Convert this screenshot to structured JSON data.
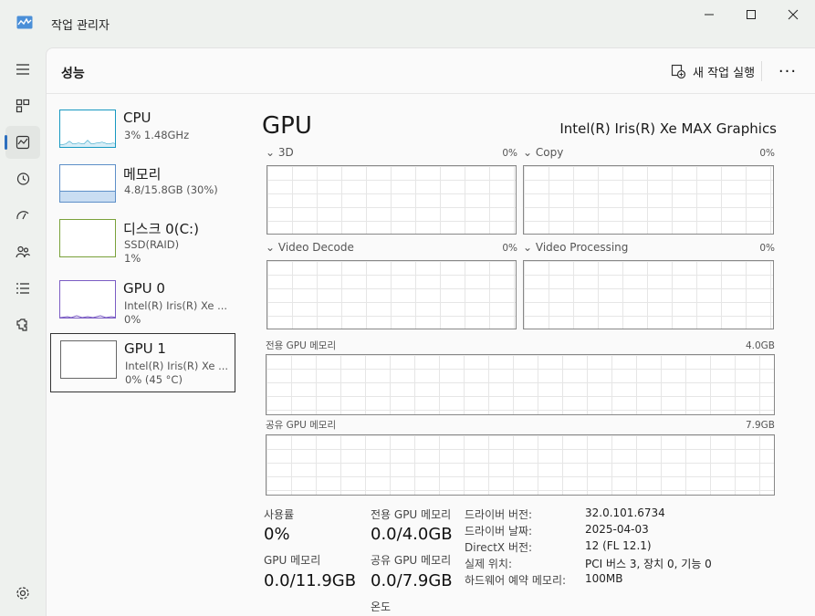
{
  "window": {
    "title": "작업 관리자"
  },
  "header": {
    "title": "성능",
    "new_task_label": "새 작업 실행",
    "more_label": "···"
  },
  "nav": {
    "icons": [
      "menu-icon",
      "processes-icon",
      "performance-icon",
      "app-history-icon",
      "startup-apps-icon",
      "users-icon",
      "details-icon",
      "services-icon",
      "settings-icon"
    ]
  },
  "devices": [
    {
      "name": "CPU",
      "line1": "3% 1.48GHz",
      "line2": ""
    },
    {
      "name": "메모리",
      "line1": "4.8/15.8GB (30%)",
      "line2": ""
    },
    {
      "name": "디스크 0(C:)",
      "line1": "SSD(RAID)",
      "line2": "1%"
    },
    {
      "name": "GPU 0",
      "line1": "Intel(R) Iris(R) Xe ...",
      "line2": "0%"
    },
    {
      "name": "GPU 1",
      "line1": "Intel(R) Iris(R) Xe ...",
      "line2": "0% (45 °C)"
    }
  ],
  "detail": {
    "title": "GPU",
    "model": "Intel(R) Iris(R) Xe MAX Graphics",
    "engines": [
      {
        "label": "3D",
        "pct": "0%"
      },
      {
        "label": "Copy",
        "pct": "0%"
      },
      {
        "label": "Video Decode",
        "pct": "0%"
      },
      {
        "label": "Video Processing",
        "pct": "0%"
      }
    ],
    "dedicated_mem": {
      "label": "전용 GPU 메모리",
      "max": "4.0GB"
    },
    "shared_mem": {
      "label": "공유 GPU 메모리",
      "max": "7.9GB"
    }
  },
  "stats": {
    "usage_label": "사용률",
    "usage_value": "0%",
    "gpu_mem_label": "GPU 메모리",
    "gpu_mem_value": "0.0/11.9GB",
    "ded_label": "전용 GPU 메모리",
    "ded_value": "0.0/4.0GB",
    "shared_label": "공유 GPU 메모리",
    "shared_value": "0.0/7.9GB",
    "temp_label": "온도"
  },
  "info": [
    {
      "k": "드라이버 버전:",
      "v": "32.0.101.6734"
    },
    {
      "k": "드라이버 날짜:",
      "v": "2025-04-03"
    },
    {
      "k": "DirectX 버전:",
      "v": "12 (FL 12.1)"
    },
    {
      "k": "실제 위치:",
      "v": "PCI 버스 3, 장치 0, 기능 0"
    },
    {
      "k": "하드웨어 예약 메모리:",
      "v": "100MB"
    }
  ],
  "colors": {
    "accent": "#2c6fbe",
    "cpu": "#1798c1",
    "memory": "#8fb9e3",
    "gpu": "#7b5cc4"
  }
}
